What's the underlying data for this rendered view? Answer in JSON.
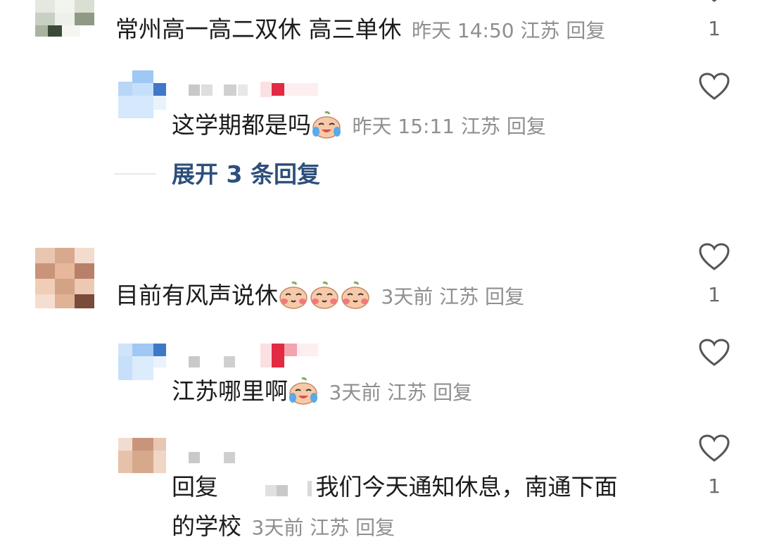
{
  "comments": [
    {
      "text": "常州高一高二双休 高三单休",
      "time": "昨天 14:50",
      "location": "江苏",
      "reply_label": "回复",
      "like_count": "1",
      "replies": [
        {
          "text": "这学期都是吗",
          "time": "昨天 15:11",
          "location": "江苏",
          "reply_label": "回复"
        }
      ],
      "expand_label": "展开 3 条回复"
    },
    {
      "text": "目前有风声说休",
      "time": "3天前",
      "location": "江苏",
      "reply_label": "回复",
      "like_count": "1",
      "replies": [
        {
          "text": "江苏哪里啊",
          "time": "3天前",
          "location": "江苏",
          "reply_label": "回复"
        },
        {
          "prefix": "回复",
          "text": "我们今天通知休息，南通下面",
          "text_line2": "的学校",
          "time": "3天前",
          "location": "江苏",
          "reply_label": "回复",
          "like_count": "1"
        }
      ]
    }
  ],
  "icons": {
    "like": "heart-outline-icon",
    "emoji_cry": "crying-laughing-emoji-icon",
    "emoji_blush": "blushing-emoji-icon"
  },
  "colors": {
    "expand_link": "#2d4f7c",
    "meta_text": "#8f8f8f",
    "heart_stroke": "#555555"
  }
}
